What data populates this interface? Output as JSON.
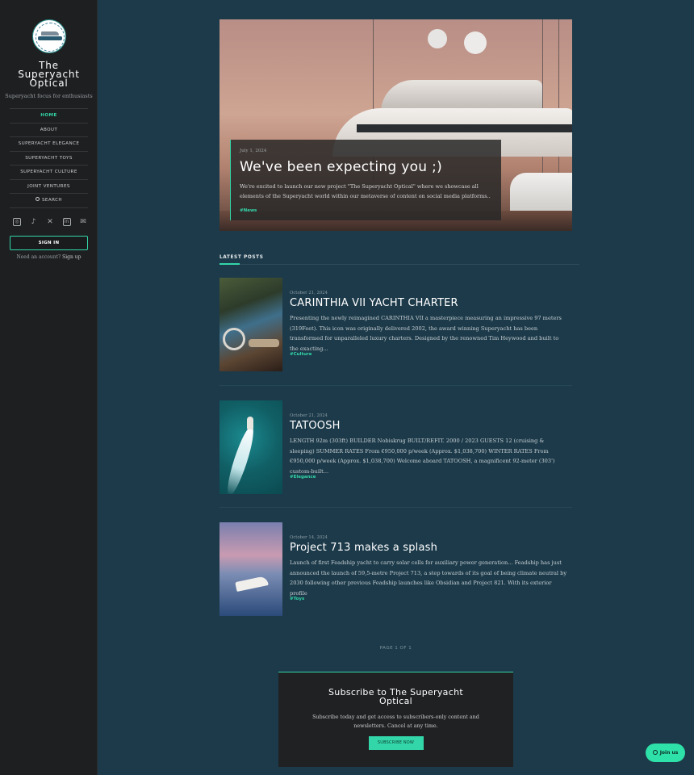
{
  "sidebar": {
    "brand_line1": "The",
    "brand_line2": "Superyacht",
    "brand_line3": "Optical",
    "tagline": "Superyacht focus for enthusiasts",
    "logo_text": "THE SUPERYACHT OPTICAL",
    "nav": [
      {
        "label": "HOME",
        "active": true
      },
      {
        "label": "ABOUT"
      },
      {
        "label": "SUPERYACHT ELEGANCE"
      },
      {
        "label": "SUPERYACHT TOYS"
      },
      {
        "label": "SUPERYACHT CULTURE"
      },
      {
        "label": "JOINT VENTURES"
      },
      {
        "label": "SEARCH",
        "icon": "search-icon"
      }
    ],
    "socials": [
      "instagram-icon",
      "tiktok-icon",
      "x-icon",
      "linkedin-icon",
      "mail-icon"
    ],
    "signin_label": "SIGN IN",
    "account_prompt": "Need an account?",
    "signup_label": "Sign up"
  },
  "hero": {
    "date": "July 1, 2024",
    "title": "We've been expecting you ;)",
    "excerpt": "We're excited to launch our new project \"The Superyacht Optical\" where we showcase all elements of the Superyacht world within our metaverse of content on social media platforms..",
    "tag": "#News"
  },
  "latest": {
    "label": "LATEST POSTS"
  },
  "posts": [
    {
      "date": "October 21, 2024",
      "title": "CARINTHIA VII YACHT CHARTER",
      "excerpt": "Presenting the newly reimagined CARINTHIA VII a masterpiece measuring an impressive 97 meters (319Feet). This icon was originally delivered 2002, the award winning Superyacht has been transformed for unparalleled luxury charters. Designed by the renowned Tim Heywood and built to the exacting...",
      "tag": "#Culture"
    },
    {
      "date": "October 21, 2024",
      "title": "TATOOSH",
      "excerpt": "LENGTH 92m (303ft) BUILDER Nobiskrug BUILT/REFIT. 2000 / 2023 GUESTS 12 (cruising & sleeping) SUMMER RATES From €950,000 p/week (Approx. $1,038,700) WINTER RATES From €950,000 p/week (Approx. $1,038,700) Welcome aboard TATOOSH, a magnificent 92-meter (303') custom-built...",
      "tag": "#Elegance"
    },
    {
      "date": "October 14, 2024",
      "title": "Project 713 makes a splash",
      "excerpt": "Launch of first Feadship yacht to carry solar cells for auxiliary power generation... Feadship has just announced the launch of 59,5-metre Project 713, a step towards of its goal of being climate neutral by 2030 following other previous Feadship launches like Obsidian and Project 821. With its exterior profile",
      "tag": "#Toys"
    }
  ],
  "pager": {
    "text": "PAGE 1 OF 1"
  },
  "subscribe": {
    "title_line1": "Subscribe to The Superyacht",
    "title_line2": "Optical",
    "text": "Subscribe today and get access to subscribers-only content and newsletters. Cancel at any time.",
    "button_label": "SUBSCRIBE NOW"
  },
  "join": {
    "label": "Join us"
  },
  "colors": {
    "accent": "#33d6a8",
    "background": "#1c3a4a",
    "sidebar": "#1e1f21"
  }
}
